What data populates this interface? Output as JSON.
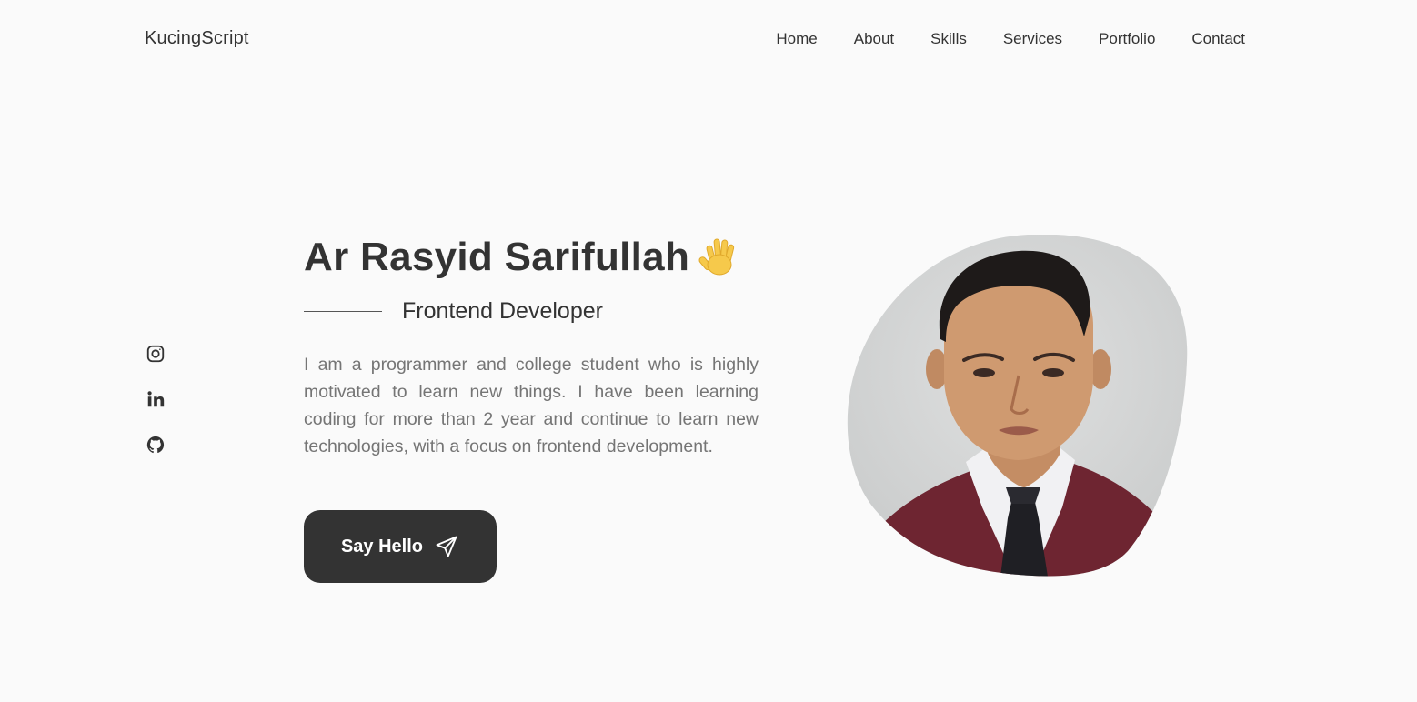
{
  "header": {
    "logo": "KucingScript",
    "nav": [
      "Home",
      "About",
      "Skills",
      "Services",
      "Portfolio",
      "Contact"
    ]
  },
  "social": [
    "instagram-icon",
    "linkedin-icon",
    "github-icon"
  ],
  "hero": {
    "name": "Ar Rasyid Sarifullah",
    "wave_icon": "waving-hand-icon",
    "subtitle": "Frontend Developer",
    "description": "I am a programmer and college student who is highly motivated to learn new things. I have been learning coding for more than 2 year and continue to learn new technologies, with a focus on frontend development.",
    "cta_label": "Say Hello",
    "cta_icon": "send-icon"
  },
  "colors": {
    "background": "#fafafa",
    "text": "#333333",
    "muted": "#757575",
    "button": "#333333",
    "button_text": "#ffffff",
    "wave": "#f6c94b"
  }
}
